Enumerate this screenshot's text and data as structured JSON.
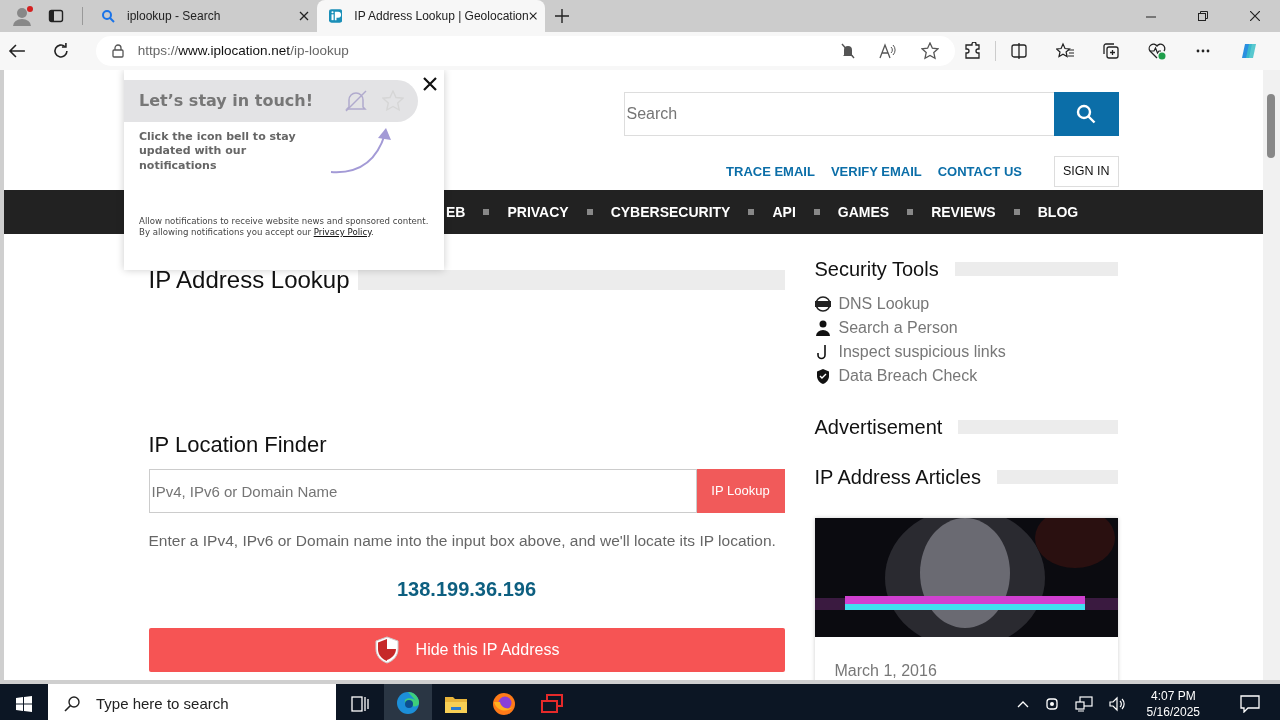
{
  "browser": {
    "tabs": [
      {
        "title": "iplookup - Search",
        "selected": false
      },
      {
        "title": "IP Address Lookup | Geolocation",
        "selected": true
      }
    ],
    "url": {
      "scheme": "https://",
      "host": "www.iplocation.net",
      "path": "/ip-lookup"
    }
  },
  "header": {
    "search": {
      "placeholder": "Search"
    },
    "links": [
      "TRACE EMAIL",
      "VERIFY EMAIL",
      "CONTACT US"
    ],
    "sign_in": "SIGN IN"
  },
  "nav": [
    "EB",
    "PRIVACY",
    "CYBERSECURITY",
    "API",
    "GAMES",
    "REVIEWS",
    "BLOG"
  ],
  "popup": {
    "title": "Let’s stay in touch!",
    "text": "Click the icon bell to stay updated with our notifications",
    "consent": "Allow notifications to receive website news and sponsored content. By allowing notifications you accept our",
    "consent_link": "Privacy Policy",
    "consent_end": "."
  },
  "main": {
    "title": "IP Address Lookup",
    "finder_title": "IP Location Finder",
    "input": {
      "placeholder": "IPv4, IPv6 or Domain Name"
    },
    "lookup_button": "IP Lookup",
    "hint": "Enter a IPv4, IPv6 or Domain name into the input box above, and we'll locate its IP location.",
    "ip": "138.199.36.196",
    "hide_button": "Hide this IP Address"
  },
  "sidebar": {
    "tools_title": "Security Tools",
    "tools": [
      {
        "label": "DNS Lookup"
      },
      {
        "label": "Search a Person"
      },
      {
        "label": "Inspect suspicious links"
      },
      {
        "label": "Data Breach Check"
      }
    ],
    "ad_title": "Advertisement",
    "articles_title": "IP Address Articles",
    "articles": [
      {
        "kind": "picture",
        "date": "March 1, 2016"
      }
    ]
  },
  "taskbar": {
    "search_placeholder": "Type here to search",
    "apps": [
      {
        "selected": false
      },
      {
        "selected": true
      },
      {
        "selected": false
      },
      {
        "selected": false
      },
      {
        "selected": false
      }
    ],
    "time": "4:07 PM",
    "date": "5/16/2025"
  }
}
